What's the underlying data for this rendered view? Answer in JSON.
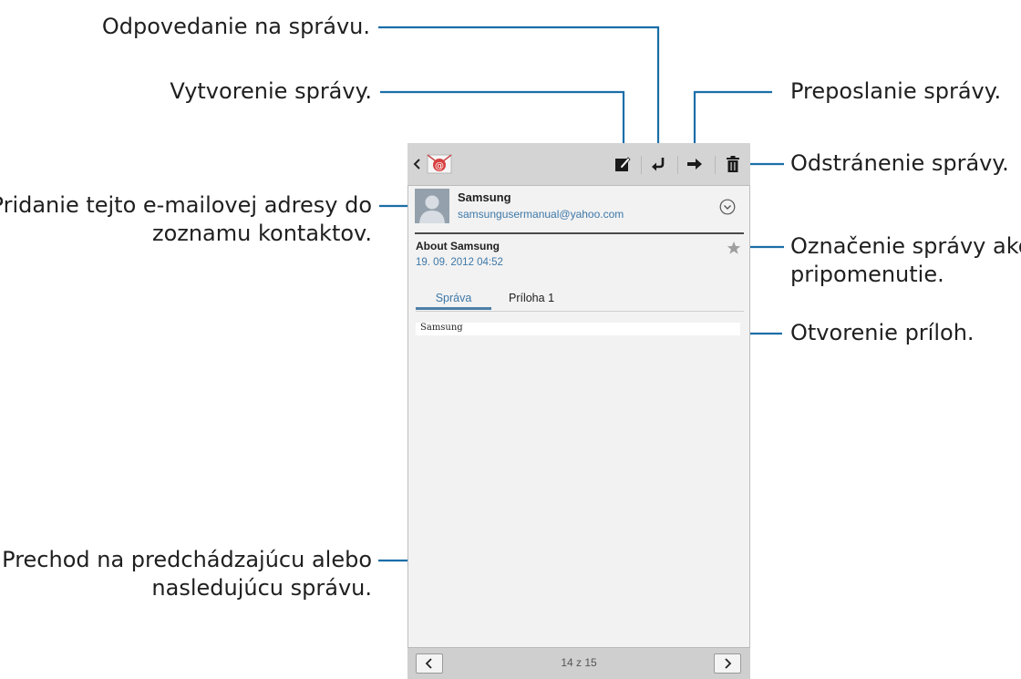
{
  "callouts": {
    "reply": "Odpovedanie na správu.",
    "compose": "Vytvorenie správy.",
    "forward": "Preposlanie správy.",
    "delete": "Odstránenie správy.",
    "add_contact_line1": "Pridanie tejto e-mailovej adresy do",
    "add_contact_line2": "zoznamu kontaktov.",
    "star_line1": "Označenie správy ako",
    "star_line2": "pripomenutie.",
    "attachments": "Otvorenie príloh.",
    "navigate_line1": "Prechod na predchádzajúcu alebo",
    "navigate_line2": "nasledujúcu správu."
  },
  "toolbar": {
    "back_icon": "chevron-left-icon",
    "app_icon": "email-app-icon",
    "compose_icon": "compose-icon",
    "reply_icon": "reply-icon",
    "forward_icon": "forward-icon",
    "delete_icon": "trash-icon"
  },
  "message": {
    "sender_name": "Samsung",
    "sender_email": "samsungusermanual@yahoo.com",
    "subject": "About Samsung",
    "date": "19. 09. 2012  04:52",
    "body": "Samsung"
  },
  "tabs": [
    {
      "label": "Správa",
      "active": true
    },
    {
      "label": "Príloha 1",
      "active": false
    }
  ],
  "pager": {
    "counter": "14 z 15"
  },
  "colors": {
    "accent": "#3e78a8",
    "callout_line": "#1b6ea8",
    "toolbar_bg": "#d4d4d4"
  }
}
